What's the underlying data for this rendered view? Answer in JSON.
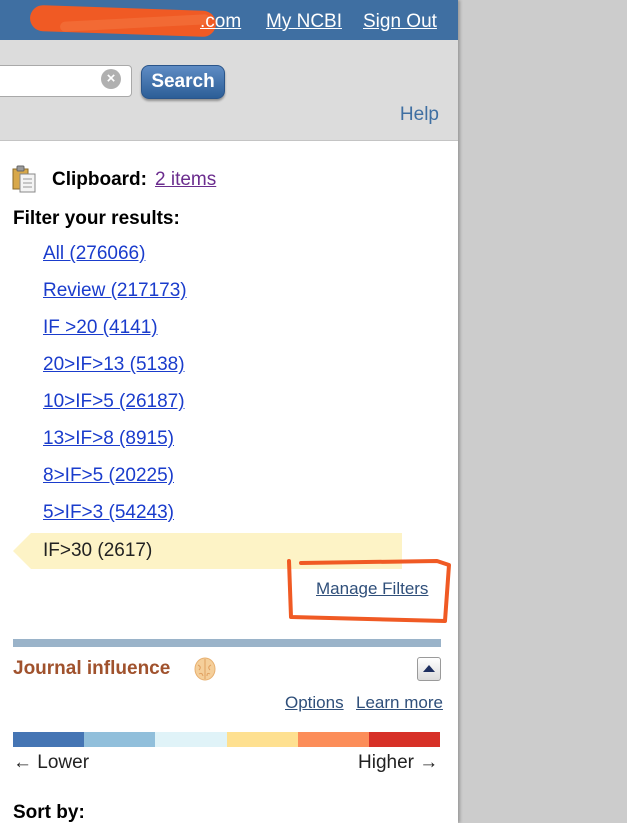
{
  "header": {
    "account_text": ".com",
    "my_ncbi": "My NCBI",
    "sign_out": "Sign Out"
  },
  "search": {
    "value": "",
    "clear_icon": "clear-x-icon",
    "button_label": "Search",
    "help": "Help"
  },
  "clipboard": {
    "icon": "clipboard-icon",
    "label": "Clipboard:",
    "link": "2 items"
  },
  "filters": {
    "heading": "Filter your results:",
    "items": [
      "All (276066)",
      "Review (217173)",
      "IF >20 (4141)",
      "20>IF>13 (5138)",
      "10>IF>5 (26187)",
      "13>IF>8 (8915)",
      "8>IF>5 (20225)",
      "5>IF>3 (54243)"
    ],
    "active": "IF>30 (2617)",
    "manage": "Manage Filters"
  },
  "journal_influence": {
    "title": "Journal influence",
    "icon": "brain-icon",
    "collapse_icon": "collapse-up-icon",
    "options": "Options",
    "learn_more": "Learn more",
    "scale_colors": [
      "#4575b4",
      "#91bfdb",
      "#e0f3f8",
      "#fee090",
      "#fc8d59",
      "#d73027"
    ],
    "lower": "← Lower",
    "higher": "Higher →"
  },
  "sort": {
    "label": "Sort by:"
  },
  "colors": {
    "header_bg": "#3f6fa2",
    "link": "#1a3ccc",
    "annotation": "#f05a24",
    "active_filter_bg": "#fdf3c6"
  }
}
